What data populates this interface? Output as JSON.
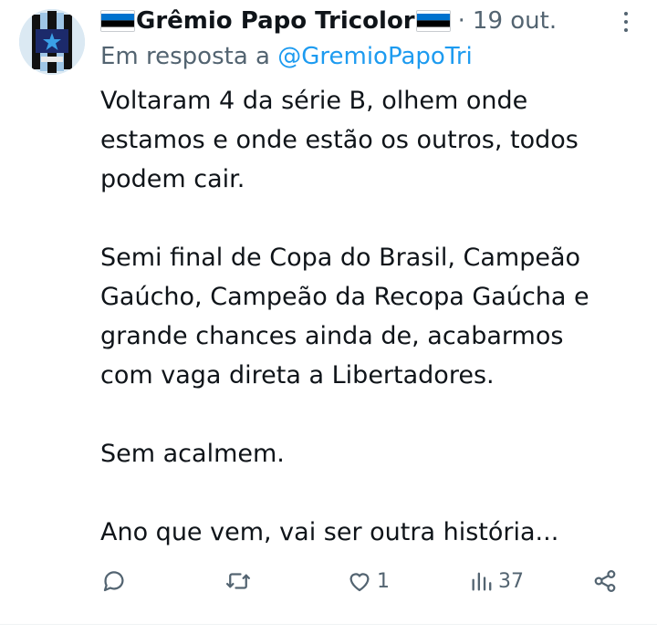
{
  "tweet": {
    "display_name": "Grêmio Papo Tricolor",
    "separator": "·",
    "date": "19 out.",
    "reply_prefix": "Em resposta a",
    "reply_handle": "@GremioPapoTri",
    "paragraphs": [
      [
        "Voltaram 4 da série B, olhem onde",
        "estamos e onde estão os outros, todos",
        "podem cair."
      ],
      [
        "Semi final de Copa do Brasil, Campeão",
        "Gaúcho, Campeão da Recopa Gaúcha e",
        "grande chances ainda de, acabarmos",
        "com vaga direta a Libertadores."
      ],
      [
        "Sem acalmem."
      ],
      [
        "Ano que vem, vai ser outra história..."
      ]
    ],
    "flags": [
      "flag-estonia-icon",
      "flag-estonia-icon"
    ]
  },
  "actions": {
    "reply_icon": "reply-icon",
    "retweet_icon": "retweet-icon",
    "like_icon": "heart-icon",
    "like_count": "1",
    "views_icon": "views-icon",
    "views_count": "37",
    "share_icon": "share-icon"
  },
  "colors": {
    "text": "#0f1419",
    "secondary": "#536471",
    "link": "#1d9bf0",
    "flag_blue": "#0072ce",
    "flag_black": "#000000",
    "flag_white": "#ffffff"
  }
}
